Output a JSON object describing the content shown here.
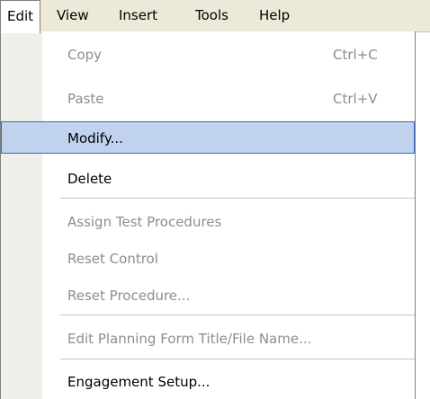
{
  "menubar": {
    "items": [
      {
        "label": "Edit"
      },
      {
        "label": "View"
      },
      {
        "label": "Insert"
      },
      {
        "label": "Tools"
      },
      {
        "label": "Help"
      }
    ]
  },
  "edit_menu": {
    "items": [
      {
        "label": "Copy",
        "shortcut": "Ctrl+C",
        "state": "disabled"
      },
      {
        "label": "Paste",
        "shortcut": "Ctrl+V",
        "state": "disabled"
      },
      {
        "label": "Modify...",
        "state": "highlighted"
      },
      {
        "label": "Delete",
        "state": "enabled"
      },
      {
        "label": "Assign Test Procedures",
        "state": "disabled"
      },
      {
        "label": "Reset Control",
        "state": "disabled"
      },
      {
        "label": "Reset Procedure...",
        "state": "disabled"
      },
      {
        "label": "Edit Planning Form Title/File Name...",
        "state": "disabled"
      },
      {
        "label": "Engagement Setup...",
        "state": "enabled"
      }
    ]
  },
  "colors": {
    "menubar_bg": "#ece9d8",
    "highlight_bg": "#c1d2ee",
    "highlight_border": "#316ac5",
    "disabled_text": "#8d8d8d"
  }
}
